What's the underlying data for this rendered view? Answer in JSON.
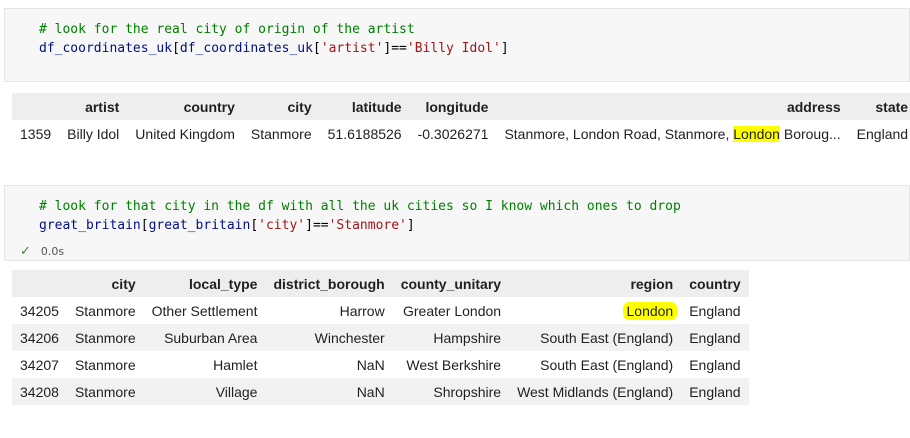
{
  "cell1": {
    "comment": "# look for the real city of origin of the artist",
    "code_parts": [
      "df_coordinates_uk",
      "[",
      "df_coordinates_uk",
      "[",
      "'artist'",
      "]==",
      "'Billy Idol'",
      "]"
    ]
  },
  "table1": {
    "columns": [
      "",
      "artist",
      "country",
      "city",
      "latitude",
      "longitude",
      "address",
      "state"
    ],
    "row": {
      "index": "1359",
      "artist": "Billy Idol",
      "country": "United Kingdom",
      "city": "Stanmore",
      "latitude": "51.6188526",
      "longitude": "-0.3026271",
      "address_before": "Stanmore, London Road, Stanmore, ",
      "address_highlight": "London",
      "address_after": " Boroug...",
      "state": "England"
    }
  },
  "cell2": {
    "comment": "# look for that city in the df with all the uk cities so I know which ones to drop",
    "code_parts": [
      "great_britain",
      "[",
      "great_britain",
      "[",
      "'city'",
      "]==",
      "'Stanmore'",
      "]"
    ],
    "status_time": "0.0s"
  },
  "table2": {
    "columns": [
      "",
      "city",
      "local_type",
      "district_borough",
      "county_unitary",
      "region",
      "country"
    ],
    "rows": [
      {
        "index": "34205",
        "city": "Stanmore",
        "local_type": "Other Settlement",
        "district_borough": "Harrow",
        "county_unitary": "Greater London",
        "region": "London",
        "country": "England"
      },
      {
        "index": "34206",
        "city": "Stanmore",
        "local_type": "Suburban Area",
        "district_borough": "Winchester",
        "county_unitary": "Hampshire",
        "region": "South East (England)",
        "country": "England"
      },
      {
        "index": "34207",
        "city": "Stanmore",
        "local_type": "Hamlet",
        "district_borough": "NaN",
        "county_unitary": "West Berkshire",
        "region": "South East (England)",
        "country": "England"
      },
      {
        "index": "34208",
        "city": "Stanmore",
        "local_type": "Village",
        "district_borough": "NaN",
        "county_unitary": "Shropshire",
        "region": "West Midlands (England)",
        "country": "England"
      }
    ]
  },
  "colors": {
    "highlight": "#ffff00",
    "comment": "#008000",
    "string": "#a31515",
    "identifier": "#001080"
  },
  "icons": {
    "status": "check-icon"
  }
}
